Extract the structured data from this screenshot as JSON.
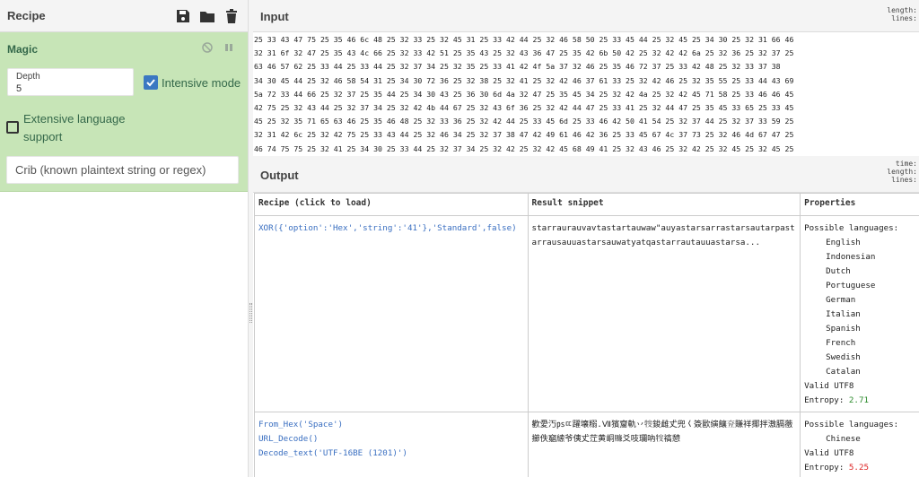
{
  "recipe": {
    "title": "Recipe",
    "magic": {
      "title": "Magic",
      "depth_label": "Depth",
      "depth_value": "5",
      "intensive_label": "Intensive mode",
      "extensive_label": "Extensive language support",
      "crib_placeholder": "Crib (known plaintext string or regex)"
    }
  },
  "input": {
    "title": "Input",
    "stats": [
      "length:",
      "lines:"
    ],
    "lines": [
      "25 33 43 47 75 25 35 46 6c 48 25 32 33 25 32 45 31 25 33 42 44 25 32 46 58 50 25 33 45 44 25 32 45 25 34 30 25 32 31 66 46",
      "32 31 6f 32 47 25 35 43 4c 66 25 32 33 42 51 25 35 43 25 32 43 36 47 25 35 42 6b 50 42 25 32 42 42 6a 25 32 36 25 32 37 25",
      "63 46 57 62 25 33 44 25 33 44 25 32 37 34 25 32 35 25 33 41 42 4f 5a 37 32 46 25 35 46 72 37 25 33 42 48 25 32 33 37 38",
      "34 30 45 44 25 32 46 58 54 31 25 34 30 72 36 25 32 38 25 32 41 25 32 42 46 37 61 33 25 32 42 46 25 32 35 55 25 33 44 43 69",
      "5a 72 33 44 66 25 32 37 25 35 44 25 34 30 43 25 36 30 6d 4a 32 47 25 35 45 34 25 32 42 4a 25 32 42 45 71 58 25 33 46 46 45",
      "42 75 25 32 43 44 25 32 37 34 25 32 42 4b 44 67 25 32 43 6f 36 25 32 42 44 47 25 33 41 25 32 44 47 25 35 45 33 65 25 33 45",
      "45 25 32 35 71 65 63 46 25 35 46 48 25 32 33 36 25 32 42 44 25 33 45 6d 25 33 46 42 50 41 54 25 32 37 44 25 32 37 33 59 25",
      "32 31 42 6c 25 32 42 75 25 33 43 44 25 32 46 34 25 32 37 38 47 42 49 61 46 42 36 25 33 45 67 4c 37 73 25 32 46 4d 67 47 25",
      "46 74 75 75 25 32 41 25 34 30 25 33 44 25 32 37 34 25 32 42 25 32 42 45 68 49 41 25 32 43 46 25 32 42 25 32 45 25 32 45 25"
    ]
  },
  "output": {
    "title": "Output",
    "stats": [
      "time:",
      "length:",
      "lines:"
    ],
    "headers": {
      "recipe": "Recipe (click to load)",
      "result": "Result snippet",
      "properties": "Properties"
    },
    "rows": [
      {
        "recipe_lines": [
          "XOR({'option':'Hex','string':'41'},'Standard',false)"
        ],
        "snippet": "starraurauvavtastartauwaw\"auyastarsarrastarsautarpastarrausauuastarsauwatyatqastarrautauuastarsa...",
        "props_header": "Possible languages:",
        "languages": [
          "English",
          "Indonesian",
          "Dutch",
          "Portuguese",
          "German",
          "Italian",
          "Spanish",
          "French",
          "Swedish",
          "Catalan"
        ],
        "valid": "Valid UTF8",
        "entropy_label": "Entropy: ",
        "entropy_value": "2.71",
        "entropy_color": "#2a8a2a"
      },
      {
        "recipe_lines": [
          "From_Hex('Space')",
          "URL_Decode()",
          "Decode_text('UTF-16BE (1201)')"
        ],
        "snippet": "歡愛汅㎰ㄸ躍壊糑.Ⅶ獱齏軌丷𤘸鋑雌𠀋兜𡿨簽歐縯饟𡗨賺祥揶拌滶膈藢擳佚竆䌇爷侇𠀋茳黄峒𧸖爻吱瓓吶𤘸禞憩",
        "props_header": "Possible languages:",
        "languages": [
          "Chinese"
        ],
        "valid": "Valid UTF8",
        "entropy_label": "Entropy: ",
        "entropy_value": "5.25",
        "entropy_color": "#dd2222"
      }
    ]
  }
}
